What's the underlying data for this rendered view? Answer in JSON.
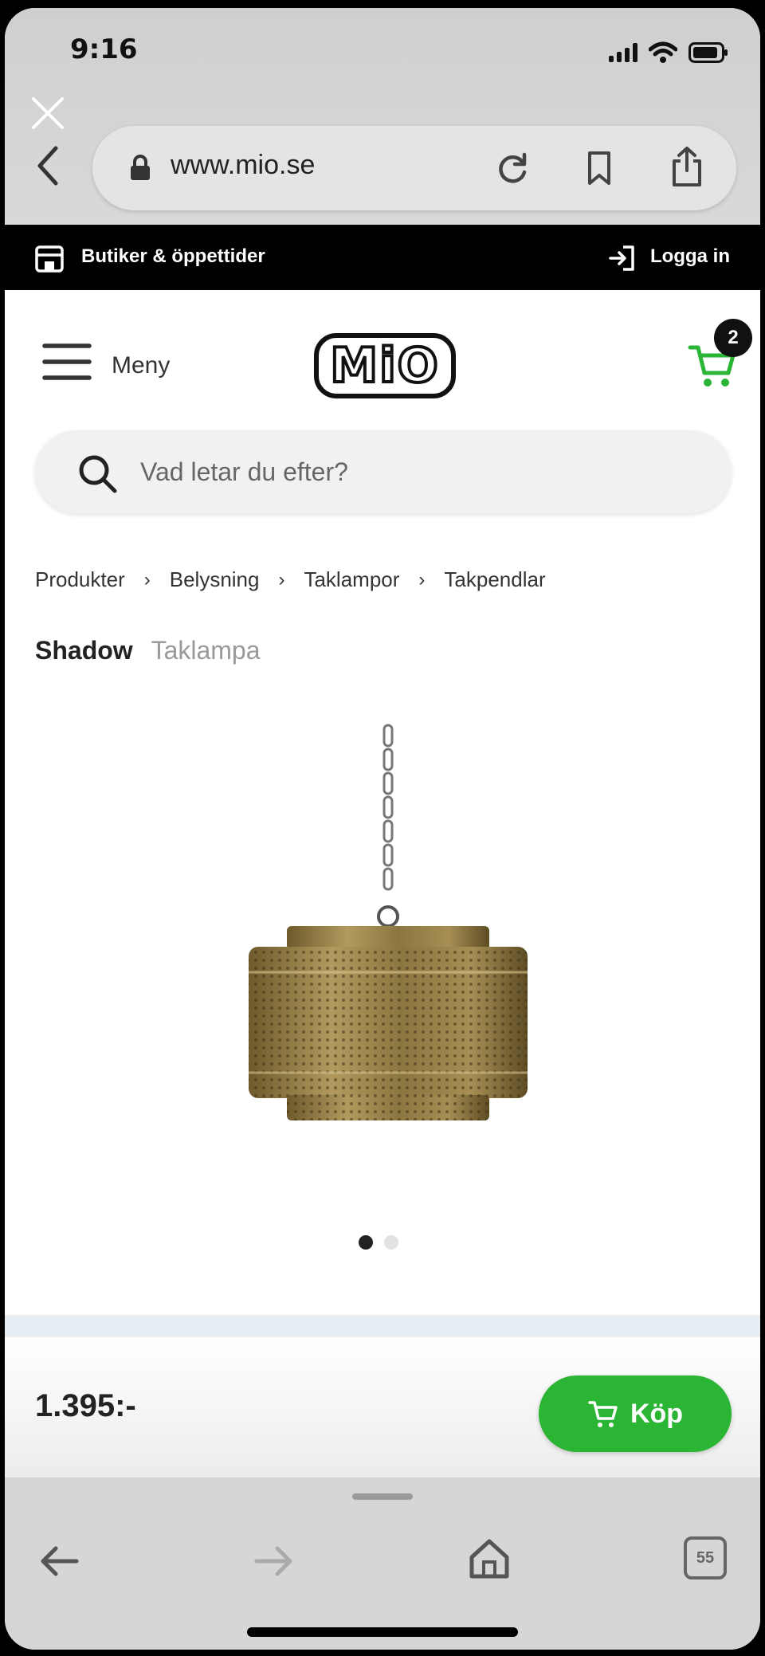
{
  "status_bar": {
    "time": "9:16"
  },
  "browser": {
    "url": "www.mio.se",
    "icons": [
      "close-icon",
      "back-chevron-icon",
      "lock-icon",
      "reload-icon",
      "bookmark-icon",
      "share-icon"
    ]
  },
  "store_bar": {
    "stores_label": "Butiker & öppettider",
    "login_label": "Logga in"
  },
  "header": {
    "menu_label": "Meny",
    "logo_text": "MiO",
    "cart_count": "2"
  },
  "search": {
    "placeholder": "Vad letar du efter?"
  },
  "breadcrumb": [
    "Produkter",
    "Belysning",
    "Taklampor",
    "Takpendlar"
  ],
  "product": {
    "name": "Shadow",
    "type": "Taklampa",
    "price": "1.395:-",
    "image_count": 2,
    "active_image": 1
  },
  "buy_button": {
    "label": "Köp"
  },
  "bottom_toolbar": {
    "tabs_count": "55"
  },
  "colors": {
    "accent_green": "#2bb534",
    "store_bar": "#000000",
    "lamp_gold": "#a08a52"
  }
}
